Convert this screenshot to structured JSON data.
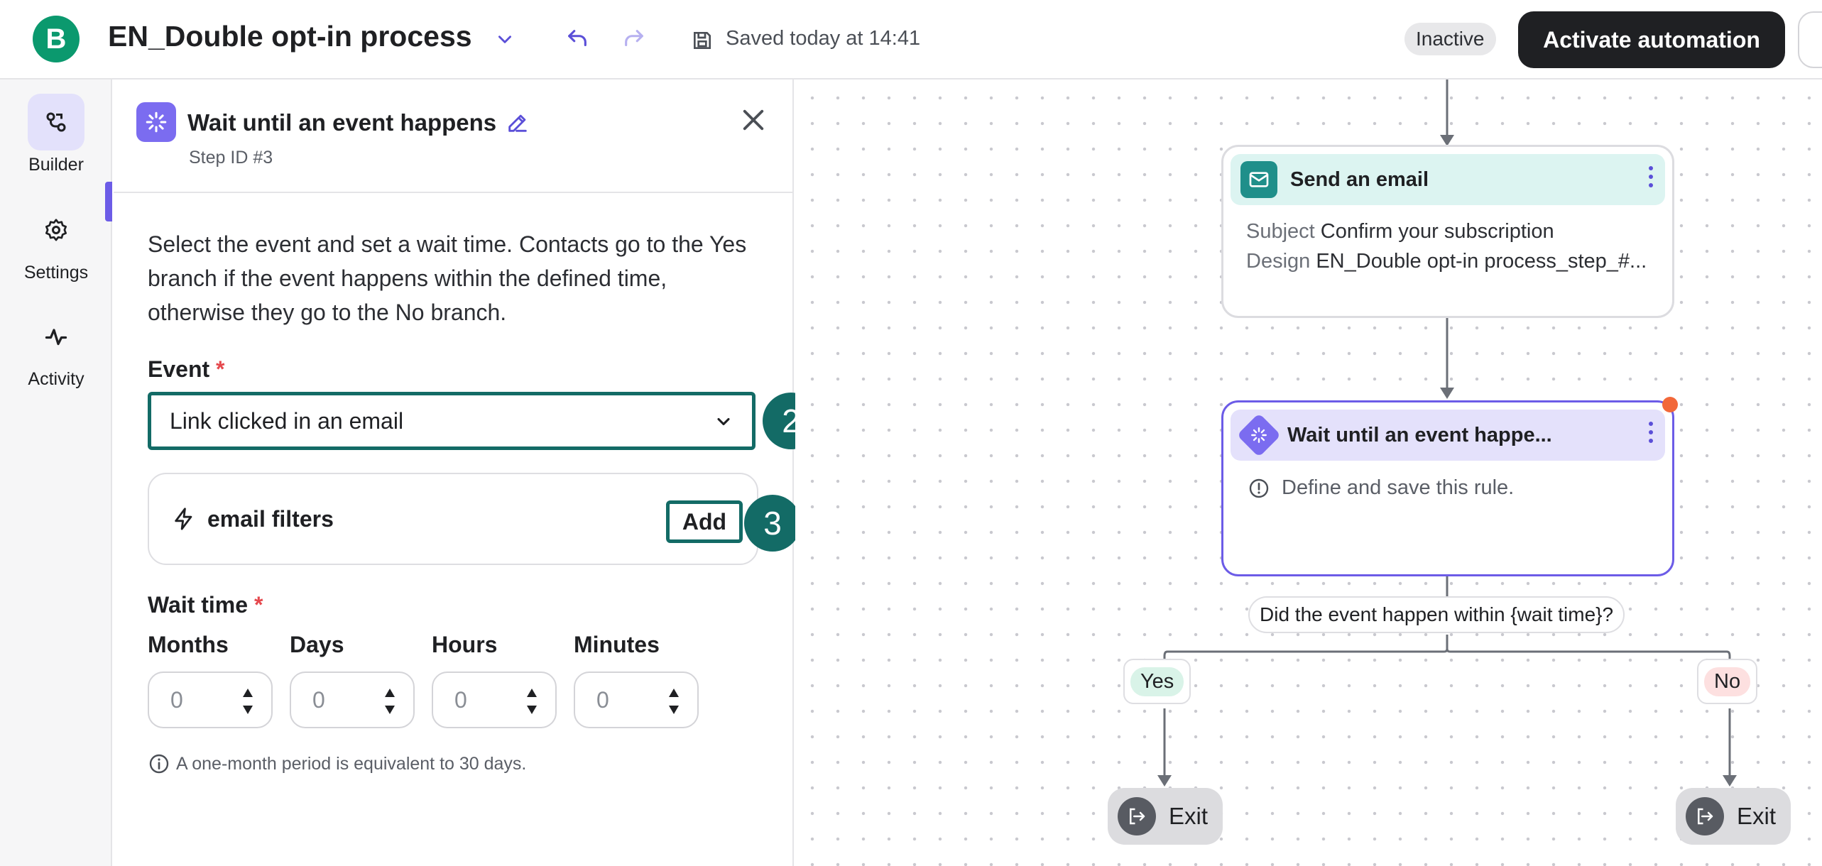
{
  "header": {
    "logo_letter": "B",
    "title": "EN_Double opt-in process",
    "saved_text": "Saved today at 14:41",
    "status_badge": "Inactive",
    "activate_label": "Activate automation"
  },
  "rail": {
    "items": [
      {
        "label": "Builder",
        "icon": "builder-icon",
        "active": true
      },
      {
        "label": "Settings",
        "icon": "gear-icon",
        "active": false
      },
      {
        "label": "Activity",
        "icon": "activity-icon",
        "active": false
      }
    ]
  },
  "panel": {
    "title": "Wait until an event happens",
    "step_id": "Step ID #3",
    "description": "Select the event and set a wait time. Contacts go to the Yes branch if the event happens within the defined time, otherwise they go to the No branch.",
    "event_label": "Event",
    "required_mark": "*",
    "event_value": "Link clicked in an email",
    "filters_label": "email filters",
    "add_label": "Add",
    "wait_time_label": "Wait time",
    "units": [
      {
        "label": "Months",
        "value": "0"
      },
      {
        "label": "Days",
        "value": "0"
      },
      {
        "label": "Hours",
        "value": "0"
      },
      {
        "label": "Minutes",
        "value": "0"
      }
    ],
    "hint": "A one-month period is equivalent to 30 days."
  },
  "annotations": {
    "select_number": "2",
    "add_number": "3"
  },
  "canvas": {
    "email_node": {
      "title": "Send an email",
      "subject_key": "Subject",
      "subject_value": "Confirm your subscription",
      "design_key": "Design",
      "design_value": "EN_Double opt-in process_step_#..."
    },
    "wait_node": {
      "title": "Wait until an event happe...",
      "warning": "Define and save this rule."
    },
    "condition": "Did the event happen within {wait time}?",
    "yes_label": "Yes",
    "no_label": "No",
    "exit_label": "Exit"
  },
  "colors": {
    "brand_green": "#0b996e",
    "accent_purple": "#6c5ce7",
    "annotation_teal": "#136b66",
    "email_header": "#dcf4f1",
    "wait_header": "#e4e1fb",
    "error_dot": "#f2683a"
  }
}
